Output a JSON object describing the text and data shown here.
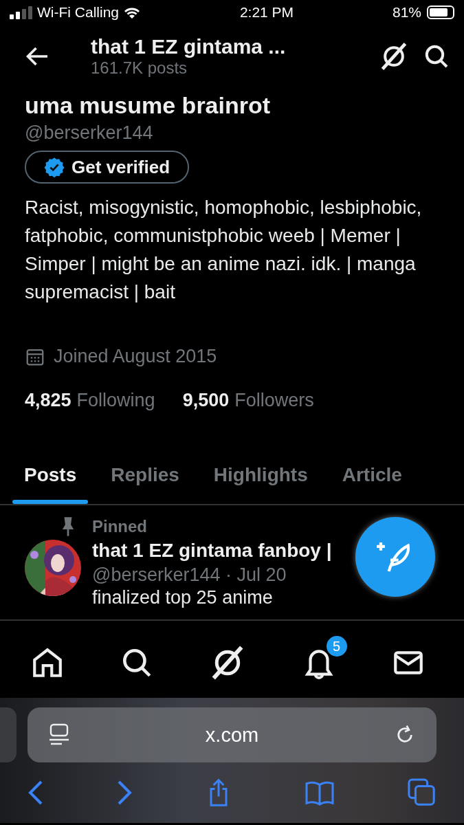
{
  "status_bar": {
    "carrier": "Wi-Fi Calling",
    "time": "2:21 PM",
    "battery": "81%"
  },
  "header": {
    "title": "that 1 EZ gintama ...",
    "subtitle": "161.7K posts"
  },
  "profile": {
    "name": "uma musume brainrot",
    "handle": "@berserker144",
    "verify_button": "Get verified",
    "bio": "Racist, misogynistic, homophobic, lesbiphobic,  fatphobic, communistphobic weeb | Memer | Simper | might be an anime nazi. idk. | manga supremacist | bait",
    "joined": "Joined August 2015",
    "stats": [
      {
        "count": "4,825",
        "label": "Following"
      },
      {
        "count": "9,500",
        "label": "Followers"
      }
    ]
  },
  "tabs": [
    {
      "label": "Posts",
      "selected": true
    },
    {
      "label": "Replies",
      "selected": false
    },
    {
      "label": "Highlights",
      "selected": false
    },
    {
      "label": "Article",
      "selected": false
    }
  ],
  "post": {
    "pinned_label": "Pinned",
    "author": "that 1 EZ gintama fanboy |",
    "handle": "@berserker144",
    "date": "· Jul 20",
    "text": "finalized top 25 anime"
  },
  "bottom_nav": [
    {
      "kind": "home"
    },
    {
      "kind": "search"
    },
    {
      "kind": "grok"
    },
    {
      "kind": "bell",
      "badge": "5"
    },
    {
      "kind": "mail"
    }
  ],
  "browser": {
    "url": "x.com"
  }
}
